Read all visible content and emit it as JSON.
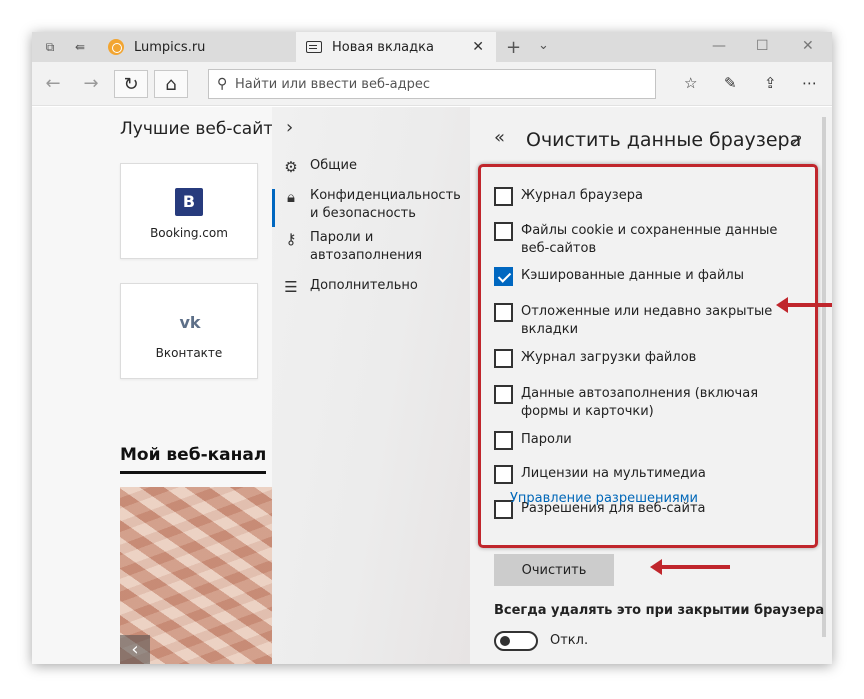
{
  "browser": {
    "tabs": [
      {
        "title": "Lumpics.ru",
        "active": false
      },
      {
        "title": "Новая вкладка",
        "active": true
      }
    ],
    "address_placeholder": "Найти или ввести веб-адрес"
  },
  "newtab": {
    "best_sites_title": "Лучшие веб-сайть",
    "tiles": [
      {
        "label": "Booking.com",
        "logo": "B"
      },
      {
        "label": "Вконтакте",
        "logo": "vk"
      }
    ],
    "feed_title": "Мой веб-канал"
  },
  "settings_nav": {
    "items": [
      {
        "label": "Общие",
        "icon": "gear-icon"
      },
      {
        "label": "Конфиденциальность и безопасность",
        "icon": "lock-icon",
        "selected": true
      },
      {
        "label": "Пароли и автозаполнения",
        "icon": "key-icon"
      },
      {
        "label": "Дополнительно",
        "icon": "sliders-icon"
      }
    ]
  },
  "clear_pane": {
    "title": "Очистить данные браузера",
    "items": [
      {
        "label": "Журнал браузера",
        "checked": false
      },
      {
        "label": "Файлы cookie и сохраненные данные веб-сайтов",
        "checked": false
      },
      {
        "label": "Кэшированные данные и файлы",
        "checked": true
      },
      {
        "label": "Отложенные или недавно закрытые вкладки",
        "checked": false
      },
      {
        "label": "Журнал загрузки файлов",
        "checked": false
      },
      {
        "label": "Данные автозаполнения (включая формы и карточки)",
        "checked": false
      },
      {
        "label": "Пароли",
        "checked": false
      },
      {
        "label": "Лицензии на мультимедиа",
        "checked": false
      },
      {
        "label": "Разрешения для веб-сайта",
        "checked": false
      }
    ],
    "manage_permissions_link": "Управление разрешениями",
    "clear_button": "Очистить",
    "always_clear_label": "Всегда удалять это при закрытии браузера",
    "toggle_state": "Откл."
  },
  "colors": {
    "accent": "#0067c0",
    "annotation_red": "#c0262c"
  }
}
